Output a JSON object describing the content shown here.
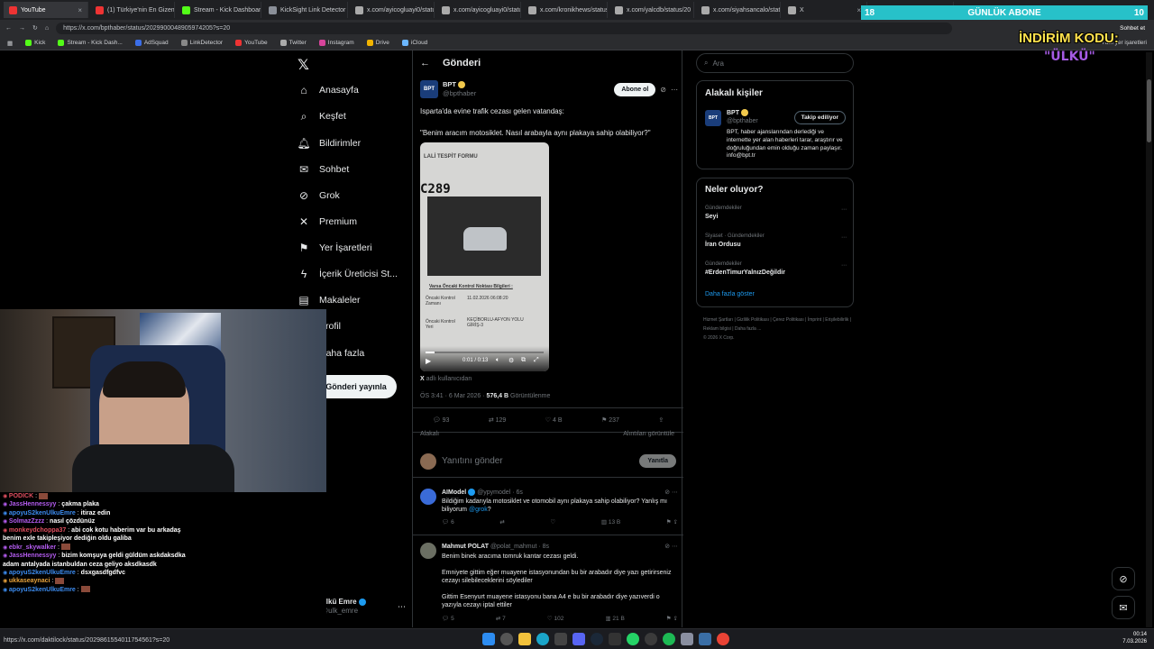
{
  "browser": {
    "tabs": [
      {
        "label": "YouTube",
        "color": "#e33"
      },
      {
        "label": "(1) Türkiye'nin En Gizem",
        "color": "#e33"
      },
      {
        "label": "Stream - Kick Dashboard",
        "color": "#53fc18"
      },
      {
        "label": "KickSight Link Detector",
        "color": "#8a8f98"
      },
      {
        "label": "x.com/ayicogluayi0/statu",
        "color": "#aaa"
      },
      {
        "label": "x.com/ayicogluayi0/statu",
        "color": "#aaa"
      },
      {
        "label": "x.com/kronikhews/status",
        "color": "#aaa"
      },
      {
        "label": "x.com/yalcdb/status/20",
        "color": "#aaa"
      },
      {
        "label": "x.com/siyahsancalo/statu",
        "color": "#aaa"
      },
      {
        "label": "X",
        "color": "#aaa"
      },
      {
        "label": "X",
        "color": "#aaa"
      }
    ],
    "url": "https://x.com/bpthaber/status/2029900048905974205?s=20",
    "status_url": "https://x.com/daktilock/status/2029861554011754561?s=20",
    "bookmarks": [
      "Kick",
      "Stream - Kick Dash...",
      "AdSquad",
      "LinkDetector",
      "YouTube",
      "Twitter",
      "Instagram",
      "Drive",
      "iCloud"
    ],
    "profile_label": "Sohbet et",
    "profile_label2": "Tüm yer işaretleri"
  },
  "overlay": {
    "sub_left": "18",
    "sub_title": "GÜNLÜK ABONE",
    "sub_right": "10",
    "promo_title": "İNDİRİM KODU:",
    "promo_code": "\"ÜLKÜ\""
  },
  "nav": {
    "items": [
      "Anasayfa",
      "Keşfet",
      "Bildirimler",
      "Sohbet",
      "Grok",
      "Premium",
      "Yer İşaretleri",
      "İçerik Üreticisi St...",
      "Makaleler",
      "Profil",
      "Daha fazla"
    ],
    "post_button": "Gönderi yayınla",
    "user_name": "Ülkü Emre",
    "user_handle": "@ulk_emre"
  },
  "post": {
    "header": "Gönderi",
    "author": "BPT",
    "handle": "@bpthaber",
    "subscribe": "Abone ol",
    "text1": "Isparta'da evine trafik cezası gelen vatandaş:",
    "text2": "\"Benim aracım motosiklet. Nasıl arabayla aynı plakaya sahip olabiliyor?\"",
    "video_plate": "C289",
    "video_header": "LALİ TESPİT FORMU",
    "video_form_title": "Varsa Öncaki Kontrol Noktası Bilgileri :",
    "video_field1": "Öncaki Kontrol Zamanı",
    "video_value1": "11.02.2026 06:08:20",
    "video_field2": "Öncaki Kontrol Yeri",
    "video_value2": "KEÇİBORLU-AFYON YOLU GİRİŞ-3",
    "video_time": "0:01 / 0:13",
    "via_prefix": "X",
    "via": "adlı kullanıcıdan",
    "timestamp": "ÖS 3:41 · 6 Mar 2026 ·",
    "views_count": "576,4 B",
    "views_label": "Görüntülenme",
    "replies": "93",
    "reposts": "129",
    "likes": "4 B",
    "bookmarks": "237",
    "relevant": "Alakalı",
    "quotes": "Alıntıları görüntüle",
    "reply_placeholder": "Yanıtını gönder",
    "reply_button": "Yanıtla"
  },
  "replies": [
    {
      "name": "AIModel",
      "handle": "@ypymodel · 6s",
      "text": "Bildiğim kadarıyla motosiklet ve otomobil aynı plakaya sahip olabiliyor? Yanlış mı biliyorum",
      "mention": "@grok",
      "tail": "?",
      "replies": "6",
      "reposts": "",
      "likes": "",
      "views": "13 B"
    },
    {
      "name": "Mahmut POLAT",
      "handle": "@polat_mahmut · 8s",
      "text1": "Benim binek aracıma tomruk kantar cezası geldi.",
      "text2": "Emniyete gittim eğer muayene istasyonundan bu bir arabadır diye yazı getirirseniz cezayı silebileceklerini söylediler",
      "text3": "Gittim Esenyurt muayene istasyonu bana A4 e bu bir arabadır diye yazıverdi o yazıyla cezayı iptal ettiler",
      "replies": "5",
      "reposts": "7",
      "likes": "102",
      "views": "21 B"
    }
  ],
  "right": {
    "search_placeholder": "Ara",
    "related_title": "Alakalı kişiler",
    "related_name": "BPT",
    "related_handle": "@bpthaber",
    "related_button": "Takip ediliyor",
    "related_bio": "BPT, haber ajanslarından derlediği ve internette yer alan haberleri tarar, araştırır ve doğruluğundan emin olduğu zaman paylaşır. info@bpt.tr",
    "trends_title": "Neler oluyor?",
    "trends": [
      {
        "meta": "Gündemdekiler",
        "name": "Seyi"
      },
      {
        "meta": "Siyaset · Gündemdekiler",
        "name": "İran Ordusu"
      },
      {
        "meta": "Gündemdekiler",
        "name": "#ErdenTimurYalnızDeğildir"
      }
    ],
    "show_more": "Daha fazla göster",
    "footer": [
      "Hizmet Şartları",
      "Gizlilik Politikası",
      "Çerez Politikası",
      "İmprint",
      "Erişilebilirlik",
      "Reklam bilgisi",
      "Daha fazla ...",
      "© 2026 X Corp."
    ]
  },
  "chat": [
    {
      "user": "PODICK",
      "color": "#e04f5f",
      "msg": ""
    },
    {
      "user": "JassHennessyy",
      "color": "#b45cf0",
      "msg": "çakma plaka"
    },
    {
      "user": "apoyuS2kenUlkuEmre",
      "color": "#3c8cf0",
      "msg": "itiraz edin"
    },
    {
      "user": "SolmazZzzz",
      "color": "#b45cf0",
      "msg": "nasıl çözdünüz"
    },
    {
      "user": "monkeydchoppa37",
      "color": "#e04f5f",
      "msg": "abi cok kotu haberim var bu arkadaş"
    },
    {
      "user": "",
      "color": "#fff",
      "msg": "benim exle takipleşiyor dediğin oldu galiba"
    },
    {
      "user": "ebkr_skywalker",
      "color": "#b45cf0",
      "msg": ""
    },
    {
      "user": "JassHennessyy",
      "color": "#b45cf0",
      "msg": "bizim komşuya geldi güldüm askdaksdka"
    },
    {
      "user": "",
      "color": "#fff",
      "msg": "adam antalyada istanbuldan ceza geliyo aksdkasdk"
    },
    {
      "user": "apoyuS2kenUlkuEmre",
      "color": "#3c8cf0",
      "msg": "dsxgasdfgdfvc"
    },
    {
      "user": "ukkaseaynaci",
      "color": "#e8a33c",
      "msg": ""
    },
    {
      "user": "apoyuS2kenUlkuEmre",
      "color": "#3c8cf0",
      "msg": ""
    }
  ],
  "taskbar": {
    "time": "00:14",
    "date": "7.03.2026"
  }
}
